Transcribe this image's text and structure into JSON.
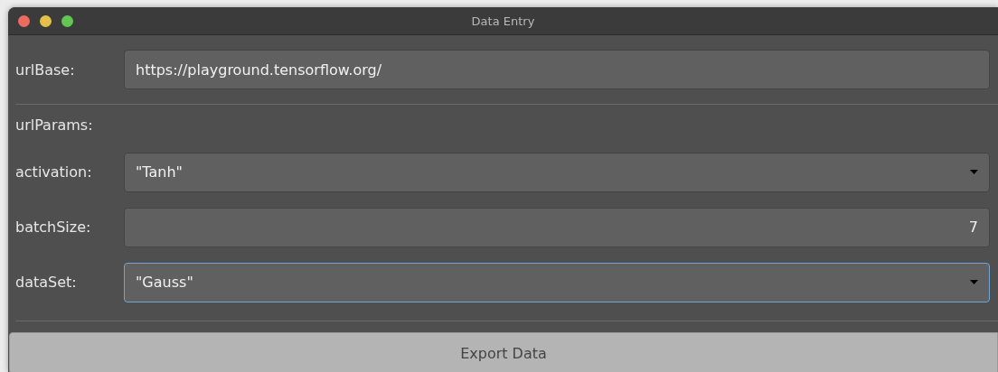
{
  "window": {
    "title": "Data Entry"
  },
  "url_base": {
    "label": "urlBase:",
    "value": "https://playground.tensorflow.org/",
    "focused": false
  },
  "url_params": {
    "label": "urlParams:",
    "fields": [
      {
        "label": "activation:",
        "kind": "dropdown",
        "value": "\"Tanh\"",
        "focused": false
      },
      {
        "label": "batchSize:",
        "kind": "number",
        "value": "7",
        "focused": false
      },
      {
        "label": "dataSet:",
        "kind": "dropdown",
        "value": "\"Gauss\"",
        "focused": true
      }
    ]
  },
  "export_button": {
    "label": "Export Data"
  }
}
